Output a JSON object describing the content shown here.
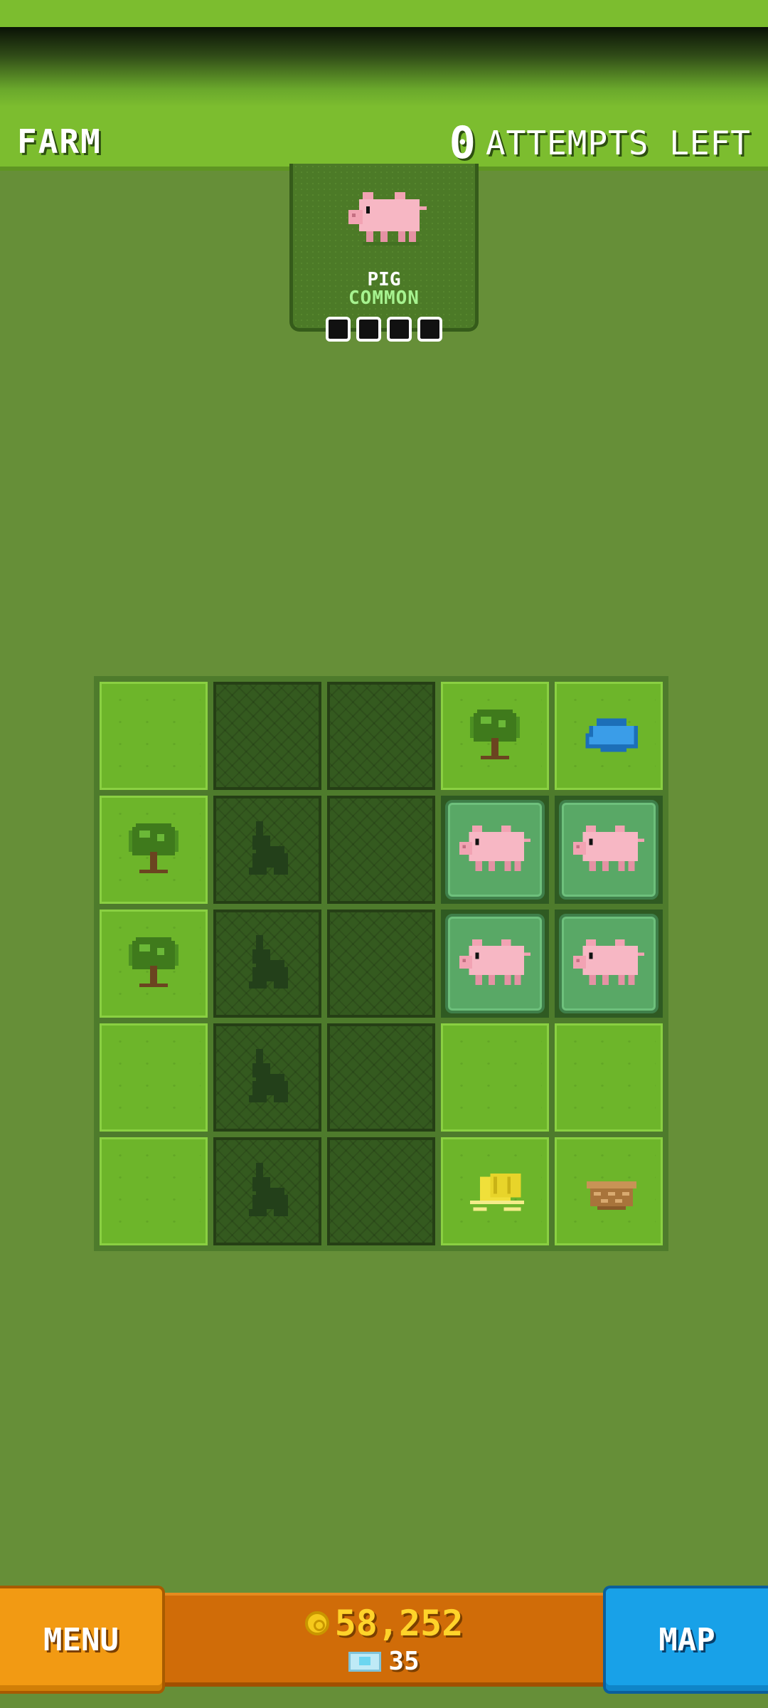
{
  "header": {
    "area_name": "FARM",
    "attempts_count": "0",
    "attempts_label": "ATTEMPTS LEFT"
  },
  "target": {
    "name": "PIG",
    "rarity": "COMMON",
    "progress_total": 4,
    "progress_found": 0,
    "icon": "pig-icon"
  },
  "board": {
    "rows": [
      [
        "grass",
        "locked",
        "locked",
        "tree",
        "pond"
      ],
      [
        "tree",
        "rabbit-silhouette",
        "locked",
        "pig",
        "pig"
      ],
      [
        "tree",
        "rabbit-silhouette",
        "locked",
        "pig",
        "pig"
      ],
      [
        "grass",
        "rabbit-silhouette",
        "locked",
        "grass",
        "grass"
      ],
      [
        "grass",
        "rabbit-silhouette",
        "locked",
        "hay",
        "basket"
      ]
    ]
  },
  "footer": {
    "menu_label": "MENU",
    "coins": "58,252",
    "gems": "35",
    "map_label": "MAP"
  },
  "colors": {
    "background": "#668f38",
    "grass_tile": "#6db52a",
    "locked_tile": "#345a1f",
    "found_tile": "#59a866",
    "menu_button": "#f29a13",
    "map_button": "#18a1e8",
    "coin_text": "#ffd32a",
    "rarity_text": "#a6f28f"
  }
}
